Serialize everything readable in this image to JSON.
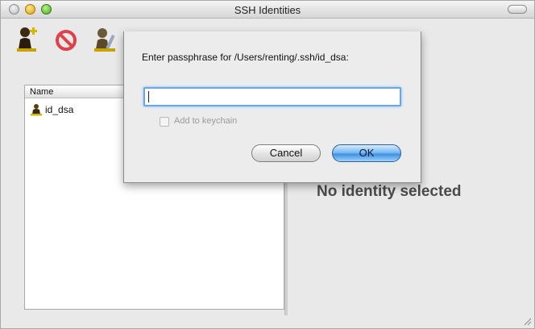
{
  "window": {
    "title": "SSH Identities"
  },
  "toolbar": {
    "items": [
      {
        "icon": "add-identity-icon"
      },
      {
        "icon": "remove-identity-icon"
      },
      {
        "icon": "edit-identity-icon"
      }
    ]
  },
  "identity_list": {
    "column_header": "Name",
    "items": [
      {
        "label": "id_dsa",
        "icon": "key-icon"
      }
    ]
  },
  "detail_pane": {
    "empty_text": "No identity selected"
  },
  "passphrase_sheet": {
    "prompt": "Enter passphrase for /Users/renting/.ssh/id_dsa:",
    "passphrase_value": "",
    "keychain_checkbox_label": "Add to keychain",
    "keychain_checked": false,
    "cancel_label": "Cancel",
    "ok_label": "OK"
  },
  "colors": {
    "focus_ring": "#6aa7e6",
    "default_button": "#3d8fe0"
  }
}
